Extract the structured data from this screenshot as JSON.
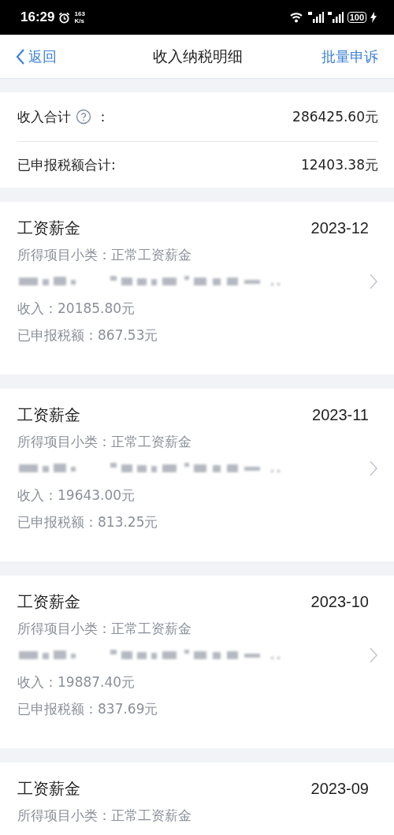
{
  "status_bar": {
    "time": "16:29",
    "speed_value": "163",
    "speed_unit": "K/s",
    "battery": "100"
  },
  "nav": {
    "back": "返回",
    "title": "收入纳税明细",
    "action": "批量申诉"
  },
  "summary": [
    {
      "label": "收入合计",
      "help": true,
      "colon": "：",
      "value": "286425.60元"
    },
    {
      "label": "已申报税额合计:",
      "help": false,
      "value": "12403.38元"
    }
  ],
  "records": [
    {
      "type": "工资薪金",
      "period": "2023-12",
      "subcategory": "所得项目小类：正常工资薪金",
      "income": "收入：20185.80元",
      "tax": "已申报税额：867.53元"
    },
    {
      "type": "工资薪金",
      "period": "2023-11",
      "subcategory": "所得项目小类：正常工资薪金",
      "income": "收入：19643.00元",
      "tax": "已申报税额：813.25元"
    },
    {
      "type": "工资薪金",
      "period": "2023-10",
      "subcategory": "所得项目小类：正常工资薪金",
      "income": "收入：19887.40元",
      "tax": "已申报税额：837.69元"
    },
    {
      "type": "工资薪金",
      "period": "2023-09",
      "subcategory": "所得项目小类：正常工资薪金"
    }
  ]
}
